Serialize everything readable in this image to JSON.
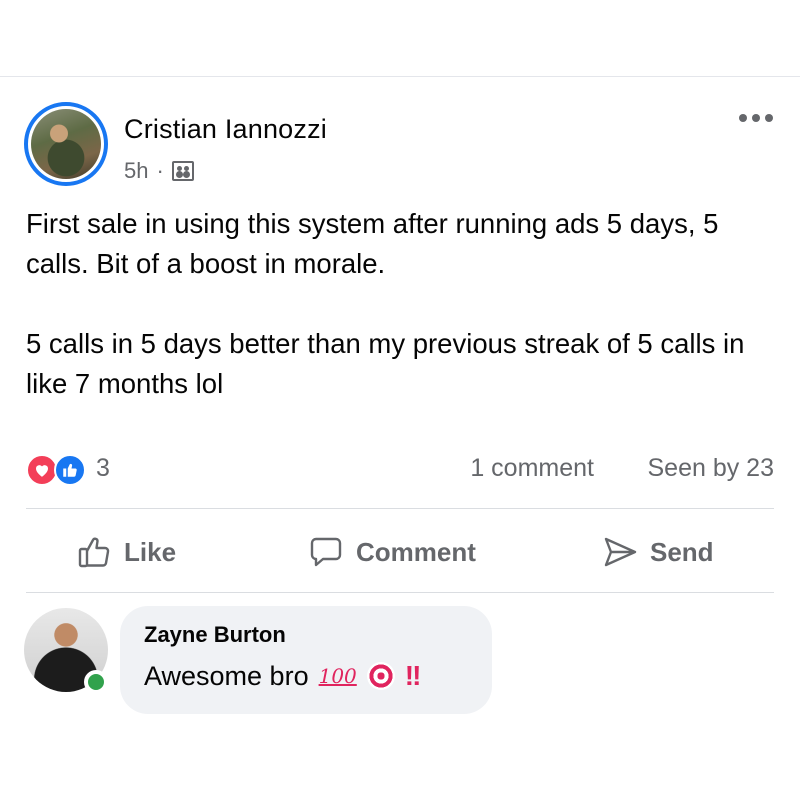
{
  "post": {
    "author": "Cristian Iannozzi",
    "time": "5h",
    "separator": "·",
    "body": "First sale in using this system after running ads 5 days, 5 calls. Bit of a boost in morale.\n\n5 calls in 5 days better than my previous streak of 5 calls in like 7 months lol",
    "reaction_count": "3",
    "comment_count": "1 comment",
    "seen_by": "Seen by 23"
  },
  "actions": {
    "like": "Like",
    "comment": "Comment",
    "send": "Send"
  },
  "comment": {
    "name": "Zayne Burton",
    "text": "Awesome bro",
    "emoji_100": "100",
    "emoji_bangs": "!!"
  },
  "icons": [
    "more-options-icon",
    "audience-friends-icon",
    "love-reaction-icon",
    "like-reaction-icon",
    "thumbs-up-icon",
    "speech-bubble-icon",
    "send-arrow-icon",
    "online-status-icon",
    "hundred-points-emoji",
    "direct-hit-emoji",
    "double-exclamation-emoji"
  ],
  "colors": {
    "brand_blue": "#1877f2",
    "love_red": "#f33e58",
    "online_green": "#31a24c",
    "muted_text": "#65676b",
    "bubble_bg": "#f0f2f5"
  }
}
